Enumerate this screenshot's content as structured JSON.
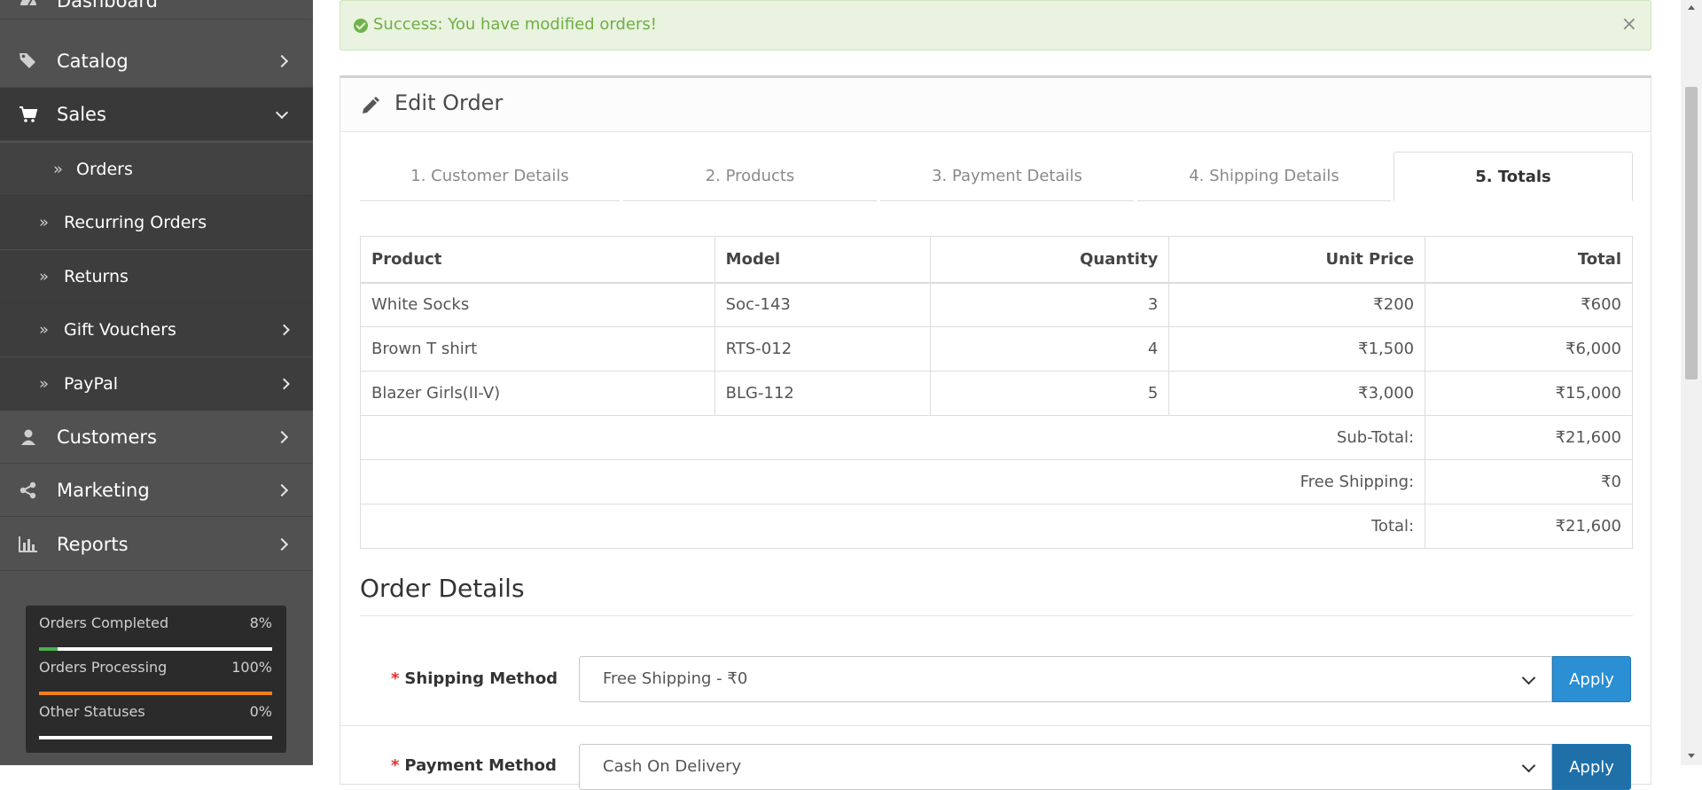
{
  "sidebar": {
    "items": [
      {
        "label": "Dashboard",
        "icon": "dashboard-icon"
      },
      {
        "label": "Catalog",
        "icon": "tags-icon"
      },
      {
        "label": "Sales",
        "icon": "shopping-cart-icon"
      },
      {
        "label": "Customers",
        "icon": "user-icon"
      },
      {
        "label": "Marketing",
        "icon": "share-icon"
      },
      {
        "label": "Reports",
        "icon": "bar-chart-icon"
      }
    ],
    "sales_sub": [
      {
        "label": "Orders",
        "active": true
      },
      {
        "label": "Recurring Orders"
      },
      {
        "label": "Returns"
      },
      {
        "label": "Gift Vouchers"
      },
      {
        "label": "PayPal"
      }
    ],
    "stats": [
      {
        "label": "Orders Completed",
        "value": "8%",
        "fraction": 0.08,
        "color": "#4caf50"
      },
      {
        "label": "Orders Processing",
        "value": "100%",
        "fraction": 1.0,
        "color": "#f0801e"
      },
      {
        "label": "Other Statuses",
        "value": "0%",
        "fraction": 0.0,
        "color": "#ffffff"
      }
    ]
  },
  "alert": {
    "message": "Success: You have modified orders!",
    "close": "×"
  },
  "panel": {
    "title": "Edit Order",
    "tabs": [
      {
        "label": "1. Customer Details"
      },
      {
        "label": "2. Products"
      },
      {
        "label": "3. Payment Details"
      },
      {
        "label": "4. Shipping Details"
      },
      {
        "label": "5. Totals",
        "active": true
      }
    ]
  },
  "table": {
    "headers": [
      "Product",
      "Model",
      "Quantity",
      "Unit Price",
      "Total"
    ],
    "rows": [
      [
        "White Socks",
        "Soc-143",
        "3",
        "₹200",
        "₹600"
      ],
      [
        "Brown T shirt",
        "RTS-012",
        "4",
        "₹1,500",
        "₹6,000"
      ],
      [
        "Blazer Girls(II-V)",
        "BLG-112",
        "5",
        "₹3,000",
        "₹15,000"
      ]
    ],
    "totals": [
      {
        "label": "Sub-Total:",
        "value": "₹21,600"
      },
      {
        "label": "Free Shipping:",
        "value": "₹0"
      },
      {
        "label": "Total:",
        "value": "₹21,600"
      }
    ]
  },
  "order_details": {
    "title": "Order Details",
    "required_mark": "*",
    "shipping": {
      "label": "Shipping Method",
      "value": "Free Shipping - ₹0",
      "button": "Apply"
    },
    "payment": {
      "label": "Payment Method",
      "value": "Cash On Delivery",
      "button": "Apply"
    }
  },
  "colors": {
    "sidebar_bg": "#515151",
    "accent_blue": "#2a8fd3",
    "success_green": "#6fae44"
  }
}
